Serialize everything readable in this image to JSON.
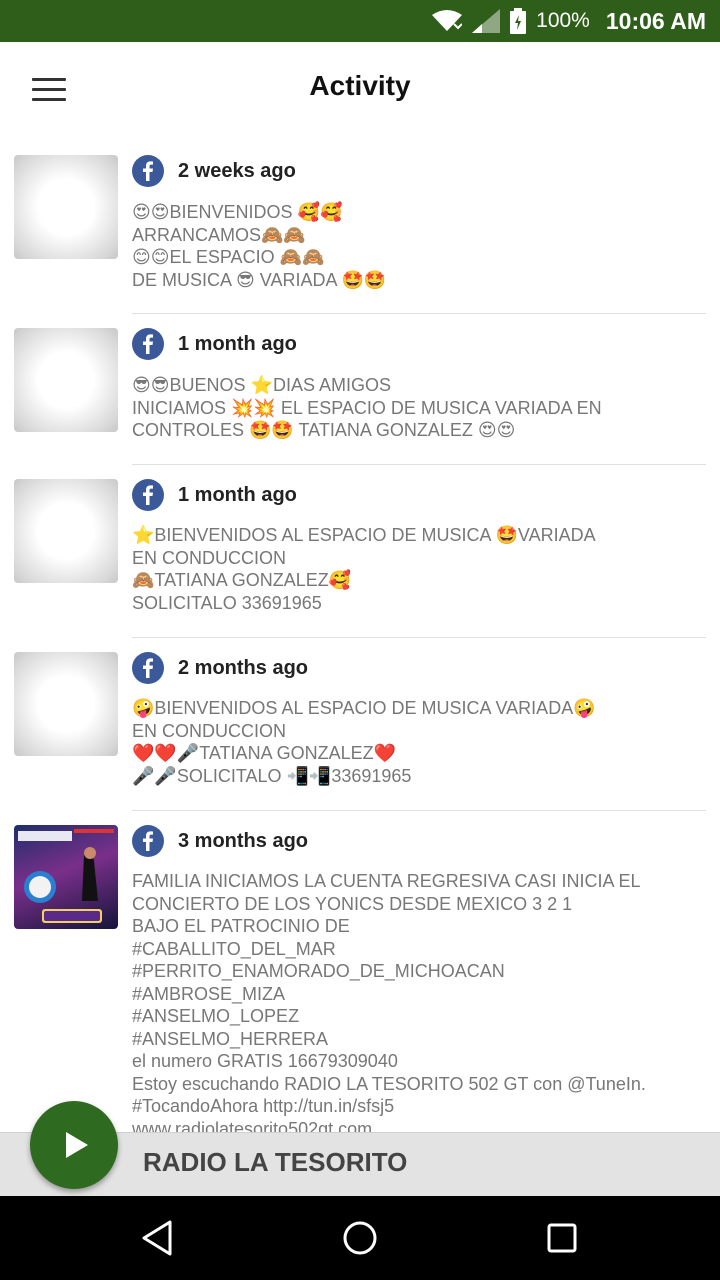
{
  "status_bar": {
    "battery": "100%",
    "time": "10:06 AM"
  },
  "app_bar": {
    "title": "Activity"
  },
  "feed": [
    {
      "time": "2 weeks ago",
      "text": "😍😍BIENVENIDOS  🥰🥰\nARRANCAMOS🙈🙈\n😊😊EL  ESPACIO 🙈🙈\nDE  MUSICA 😎 VARIADA 🤩🤩"
    },
    {
      "time": "1 month ago",
      "text": "😎😎BUENOS  ⭐DIAS  AMIGOS\nINICIAMOS 💥💥 EL ESPACIO DE MUSICA  VARIADA EN\nCONTROLES 🤩🤩 TATIANA GONZALEZ 😍😍"
    },
    {
      "time": "1 month ago",
      "text": "⭐BIENVENIDOS AL ESPACIO  DE  MUSICA  🤩VARIADA\nEN  CONDUCCION\n🙈TATIANA GONZALEZ🥰\nSOLICITALO  33691965"
    },
    {
      "time": "2 months ago",
      "text": "🤪BIENVENIDOS  AL ESPACIO DE MUSICA VARIADA🤪\nEN CONDUCCION\n❤️❤️🎤TATIANA  GONZALEZ❤️\n🎤🎤SOLICITALO  📲📲33691965"
    },
    {
      "time": "3 months ago",
      "text": "FAMILIA  INICIAMOS LA CUENTA REGRESIVA CASI  INICIA  EL\nCONCIERTO  DE LOS  YONICS  DESDE  MEXICO  3     2     1\nBAJO EL PATROCINIO DE\n#CABALLITO_DEL_MAR\n#PERRITO_ENAMORADO_DE_MICHOACAN\n#AMBROSE_MIZA\n#ANSELMO_LOPEZ\n#ANSELMO_HERRERA\nel numero GRATIS 16679309040\nEstoy escuchando RADIO LA TESORITO 502 GT con @TuneIn.\n#TocandoAhora http://tun.in/sfsj5\nwww.radiolatesorito502gt.com"
    }
  ],
  "player": {
    "title": "RADIO LA TESORITO"
  },
  "colors": {
    "status_bar": "#2f5e1a",
    "play_button": "#2e6a1f",
    "facebook": "#3b5998"
  }
}
